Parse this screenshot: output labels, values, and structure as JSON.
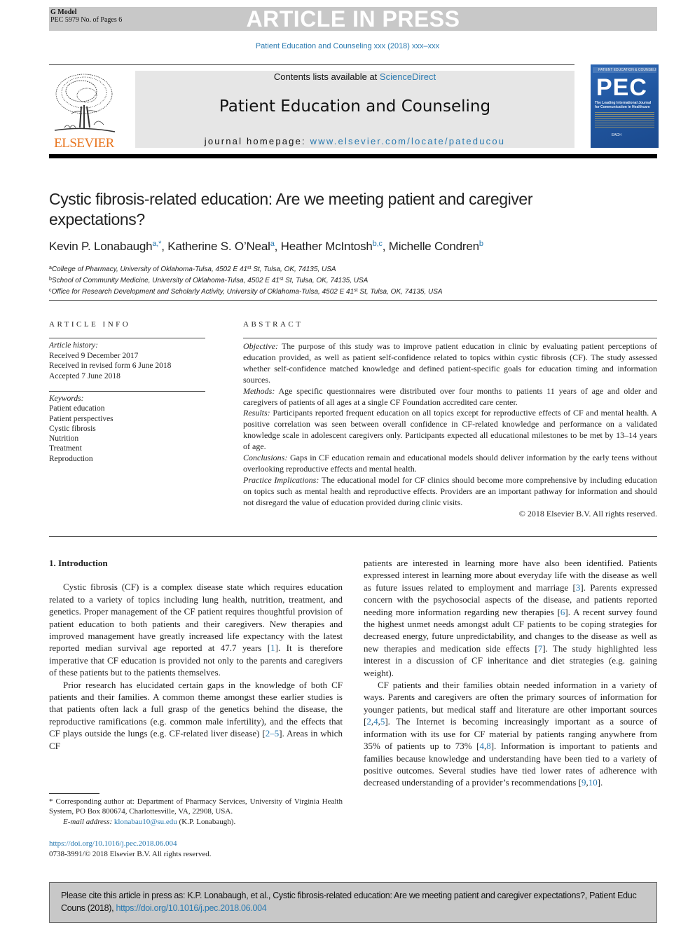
{
  "running_header": {
    "model_label": "G Model",
    "article_code": "PEC 5979 No. of Pages 6",
    "banner_text": "ARTICLE IN PRESS",
    "journal_citation": "Patient Education and Counseling xxx (2018) xxx–xxx"
  },
  "journal_header": {
    "publisher_logo_text": "ELSEVIER",
    "contents_prefix": "Contents lists available at ",
    "contents_link": "ScienceDirect",
    "journal_name": "Patient Education and Counseling",
    "homepage_prefix": "journal homepage: ",
    "homepage_link": "www.elsevier.com/locate/pateducou",
    "cover": {
      "top_strip": "PATIENT EDUCATION & COUNSELING",
      "acronym": "PEC",
      "subtitle": "The Leading International Journal for Communication in Healthcare",
      "logos": "EACH"
    },
    "colors": {
      "publisher_orange": "#e87722",
      "link_blue": "#2a7ab0",
      "header_box_gray": "#e6e6e6",
      "banner_gray": "#c8c8c8",
      "cover_blue": "#2056a0"
    }
  },
  "article": {
    "title": "Cystic fibrosis-related education: Are we meeting patient and caregiver expectations?",
    "authors": [
      {
        "name": "Kevin P. Lonabaugh",
        "sup": "a,*",
        "sep": ", "
      },
      {
        "name": "Katherine S. O’Neal",
        "sup": "a",
        "sep": ", "
      },
      {
        "name": "Heather McIntosh",
        "sup": "b,c",
        "sep": ", "
      },
      {
        "name": "Michelle Condren",
        "sup": "b",
        "sep": ""
      }
    ],
    "affiliations": [
      {
        "label": "a",
        "pre": "College of Pharmacy, University of Oklahoma-Tulsa, 4502 E 41",
        "sup": "st",
        "post": " St, Tulsa, OK, 74135, USA"
      },
      {
        "label": "b",
        "pre": "School of Community Medicine, University of Oklahoma-Tulsa, 4502 E 41",
        "sup": "st",
        "post": " St, Tulsa, OK, 74135, USA"
      },
      {
        "label": "c",
        "pre": "Office for Research Development and Scholarly Activity, University of Oklahoma-Tulsa, 4502 E 41",
        "sup": "st",
        "post": " St, Tulsa, OK, 74135, USA"
      }
    ]
  },
  "article_info": {
    "heading": "ARTICLE INFO",
    "history_label": "Article history:",
    "history": [
      "Received 9 December 2017",
      "Received in revised form 6 June 2018",
      "Accepted 7 June 2018"
    ],
    "keywords_label": "Keywords:",
    "keywords": [
      "Patient education",
      "Patient perspectives",
      "Cystic fibrosis",
      "Nutrition",
      "Treatment",
      "Reproduction"
    ]
  },
  "abstract": {
    "heading": "ABSTRACT",
    "sections": [
      {
        "label": "Objective:",
        "text": " The purpose of this study was to improve patient education in clinic by evaluating patient perceptions of education provided, as well as patient self-confidence related to topics within cystic fibrosis (CF). The study assessed whether self-confidence matched knowledge and defined patient-specific goals for education timing and information sources."
      },
      {
        "label": "Methods:",
        "text": " Age specific questionnaires were distributed over four months to patients 11 years of age and older and caregivers of patients of all ages at a single CF Foundation accredited care center."
      },
      {
        "label": "Results:",
        "text": " Participants reported frequent education on all topics except for reproductive effects of CF and mental health. A positive correlation was seen between overall confidence in CF-related knowledge and performance on a validated knowledge scale in adolescent caregivers only. Participants expected all educational milestones to be met by 13–14 years of age."
      },
      {
        "label": "Conclusions:",
        "text": " Gaps in CF education remain and educational models should deliver information by the early teens without overlooking reproductive effects and mental health."
      },
      {
        "label": "Practice Implications:",
        "text": " The educational model for CF clinics should become more comprehensive by including education on topics such as mental health and reproductive effects. Providers are an important pathway for information and should not disregard the value of education provided during clinic visits."
      }
    ],
    "copyright": "© 2018 Elsevier B.V. All rights reserved."
  },
  "body": {
    "section_heading": "1. Introduction",
    "left_paragraphs": [
      [
        {
          "t": "Cystic fibrosis (CF) is a complex disease state which requires education related to a variety of topics including lung health, nutrition, treatment, and genetics. Proper management of the CF patient requires thoughtful provision of patient education to both patients and their caregivers. New therapies and improved management have greatly increased life expectancy with the latest reported median survival age reported at 47.7 years ["
        },
        {
          "c": "1"
        },
        {
          "t": "]. It is therefore imperative that CF education is provided not only to the parents and caregivers of these patients but to the patients themselves."
        }
      ],
      [
        {
          "t": "Prior research has elucidated certain gaps in the knowledge of both CF patients and their families. A common theme amongst these earlier studies is that patients often lack a full grasp of the genetics behind the disease, the reproductive ramifications (e.g. common male infertility), and the effects that CF plays outside the lungs (e.g. CF-related liver disease) ["
        },
        {
          "c": "2–5"
        },
        {
          "t": "]. Areas in which CF"
        }
      ]
    ],
    "right_paragraphs": [
      [
        {
          "t": "patients are interested in learning more have also been identified. Patients expressed interest in learning more about everyday life with the disease as well as future issues related to employment and marriage ["
        },
        {
          "c": "3"
        },
        {
          "t": "]. Parents expressed concern with the psychosocial aspects of the disease, and patients reported needing more information regarding new therapies ["
        },
        {
          "c": "6"
        },
        {
          "t": "]. A recent survey found the highest unmet needs amongst adult CF patients to be coping strategies for decreased energy, future unpredictability, and changes to the disease as well as new therapies and medication side effects ["
        },
        {
          "c": "7"
        },
        {
          "t": "]. The study highlighted less interest in a discussion of CF inheritance and diet strategies (e.g. gaining weight)."
        }
      ],
      [
        {
          "t": "CF patients and their families obtain needed information in a variety of ways. Parents and caregivers are often the primary sources of information for younger patients, but medical staff and literature are other important sources ["
        },
        {
          "c": "2"
        },
        {
          "t": ","
        },
        {
          "c": "4"
        },
        {
          "t": ","
        },
        {
          "c": "5"
        },
        {
          "t": "]. The Internet is becoming increasingly important as a source of information with its use for CF material by patients ranging anywhere from 35% of patients up to 73% ["
        },
        {
          "c": "4"
        },
        {
          "t": ","
        },
        {
          "c": "8"
        },
        {
          "t": "]. Information is important to patients and families because knowledge and understanding have been tied to a variety of positive outcomes. Several studies have tied lower rates of adherence with decreased understanding of a provider’s recommendations ["
        },
        {
          "c": "9"
        },
        {
          "t": ","
        },
        {
          "c": "10"
        },
        {
          "t": "]."
        }
      ]
    ]
  },
  "footnote": {
    "marker": "*",
    "corresponding": " Corresponding author at: Department of Pharmacy Services, University of Virginia Health System, PO Box 800674, Charlottesville, VA, 22908, USA.",
    "email_label": "E-mail address:",
    "email": "klonabau10@su.edu",
    "email_owner": " (K.P.  Lonabaugh).",
    "doi": "https://doi.org/10.1016/j.pec.2018.06.004",
    "issn_copyright": "0738-3991/© 2018 Elsevier B.V. All rights reserved."
  },
  "citation_box": {
    "text": "Please cite this article in press as: K.P. Lonabaugh, et al., Cystic fibrosis-related education: Are we meeting patient and caregiver expectations?, Patient Educ Couns (2018), ",
    "doi_link": "https://doi.org/10.1016/j.pec.2018.06.004"
  }
}
